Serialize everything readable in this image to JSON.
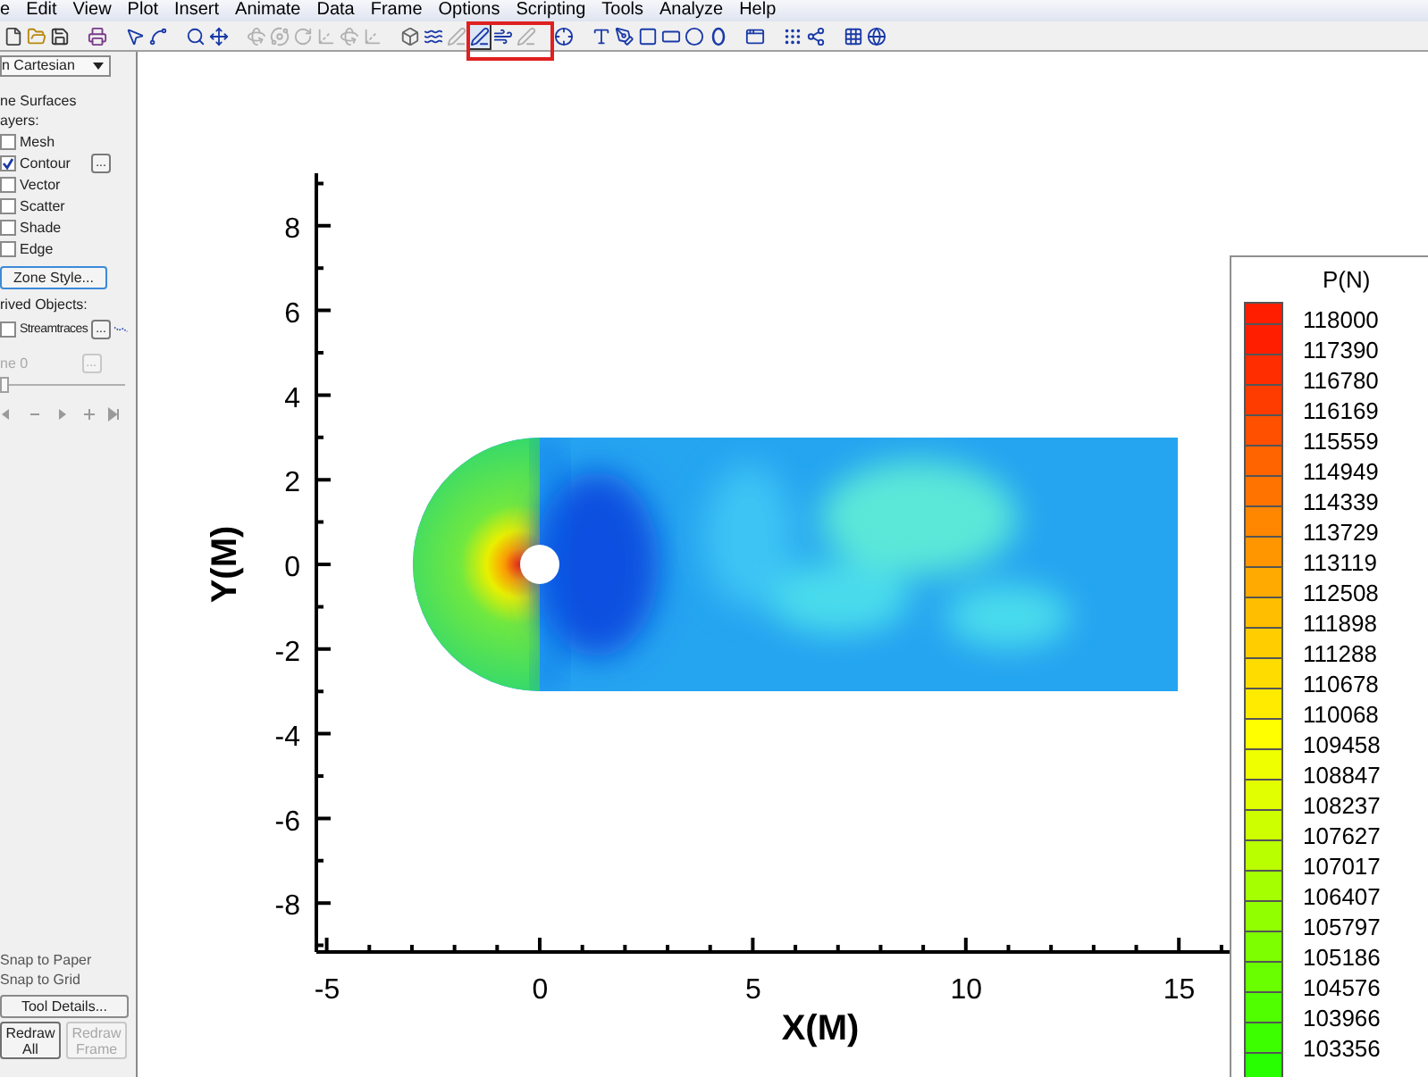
{
  "menu_bar": [
    "e",
    "Edit",
    "View",
    "Plot",
    "Insert",
    "Animate",
    "Data",
    "Frame",
    "Options",
    "Scripting",
    "Tools",
    "Analyze",
    "Help"
  ],
  "toolbar": [
    {
      "kind": "new",
      "disabled": false,
      "selected": false
    },
    {
      "kind": "open",
      "disabled": false,
      "selected": false
    },
    {
      "kind": "save",
      "disabled": false,
      "selected": false
    },
    {
      "kind": "gap"
    },
    {
      "kind": "print",
      "disabled": false,
      "selected": false
    },
    {
      "kind": "gap"
    },
    {
      "kind": "pointer",
      "disabled": false,
      "selected": false
    },
    {
      "kind": "adjust",
      "disabled": false,
      "selected": false
    },
    {
      "kind": "gap"
    },
    {
      "kind": "zoom",
      "disabled": false,
      "selected": false
    },
    {
      "kind": "move",
      "disabled": false,
      "selected": false
    },
    {
      "kind": "gap"
    },
    {
      "kind": "rotate",
      "disabled": true,
      "selected": false
    },
    {
      "kind": "orbit",
      "disabled": true,
      "selected": false
    },
    {
      "kind": "spin",
      "disabled": true,
      "selected": false
    },
    {
      "kind": "axis",
      "disabled": true,
      "selected": false
    },
    {
      "kind": "rotate",
      "disabled": true,
      "selected": false
    },
    {
      "kind": "axis",
      "disabled": true,
      "selected": false
    },
    {
      "kind": "gap"
    },
    {
      "kind": "slice",
      "disabled": false,
      "selected": false
    },
    {
      "kind": "wave",
      "disabled": false,
      "selected": false
    },
    {
      "kind": "contour",
      "disabled": true,
      "selected": false
    },
    {
      "kind": "contour-add",
      "disabled": false,
      "selected": true
    },
    {
      "kind": "streamtrace",
      "disabled": false,
      "selected": false
    },
    {
      "kind": "contour",
      "disabled": true,
      "selected": false
    },
    {
      "kind": "gap"
    },
    {
      "kind": "probe",
      "disabled": false,
      "selected": false
    },
    {
      "kind": "gap"
    },
    {
      "kind": "text",
      "disabled": false,
      "selected": false
    },
    {
      "kind": "polyline",
      "disabled": false,
      "selected": false
    },
    {
      "kind": "square",
      "disabled": false,
      "selected": false
    },
    {
      "kind": "rect",
      "disabled": false,
      "selected": false
    },
    {
      "kind": "circle",
      "disabled": false,
      "selected": false
    },
    {
      "kind": "ellipse",
      "disabled": false,
      "selected": false
    },
    {
      "kind": "gap"
    },
    {
      "kind": "frame",
      "disabled": false,
      "selected": false
    },
    {
      "kind": "gap"
    },
    {
      "kind": "scatter",
      "disabled": false,
      "selected": false
    },
    {
      "kind": "dots",
      "disabled": false,
      "selected": false
    },
    {
      "kind": "gap"
    },
    {
      "kind": "grid",
      "disabled": false,
      "selected": false
    },
    {
      "kind": "globe",
      "disabled": false,
      "selected": false
    }
  ],
  "sidebar": {
    "plot_type_dropdown": "n Cartesian",
    "zone_surfaces_label": "ne Surfaces",
    "layers_label": "ayers:",
    "layers": [
      {
        "label": "Mesh",
        "checked": false
      },
      {
        "label": "Contour",
        "checked": true,
        "details_button": "..."
      },
      {
        "label": "Vector",
        "checked": false
      },
      {
        "label": "Scatter",
        "checked": false
      },
      {
        "label": "Shade",
        "checked": false
      },
      {
        "label": "Edge",
        "checked": false
      }
    ],
    "zone_style_button": "Zone Style...",
    "derived_objects_label": "rived Objects:",
    "derived_objects": [
      {
        "label": "Streamtraces",
        "checked": false,
        "details_button": "..."
      }
    ],
    "slice_field": {
      "label": "ne 0",
      "details_button": "...",
      "disabled": true
    },
    "slider": {
      "level": 0.0
    },
    "snap_options": [
      "Snap to Paper",
      "Snap to Grid"
    ],
    "tool_details_button": "Tool Details...",
    "redraw_buttons": [
      {
        "label": "Redraw All",
        "disabled": false
      },
      {
        "label": "Redraw Frame",
        "disabled": true
      }
    ]
  },
  "plot": {
    "x_axis": {
      "title": "X(M)",
      "ticks": [
        "-5",
        "0",
        "5",
        "10",
        "15"
      ]
    },
    "y_axis": {
      "title": "Y(M)",
      "ticks": [
        "8",
        "6",
        "4",
        "2",
        "0",
        "-2",
        "-4",
        "-6",
        "-8"
      ]
    },
    "legend": {
      "title": "P(N)",
      "levels": [
        {
          "label": "118000",
          "color": "#ff1e00"
        },
        {
          "label": "117390",
          "color": "#ff2d00"
        },
        {
          "label": "116780",
          "color": "#ff3c00"
        },
        {
          "label": "116169",
          "color": "#ff5000"
        },
        {
          "label": "115559",
          "color": "#ff6400"
        },
        {
          "label": "114949",
          "color": "#ff7300"
        },
        {
          "label": "114339",
          "color": "#ff8700"
        },
        {
          "label": "113729",
          "color": "#ff9600"
        },
        {
          "label": "113119",
          "color": "#ffaa00"
        },
        {
          "label": "112508",
          "color": "#ffbe00"
        },
        {
          "label": "111898",
          "color": "#ffcd00"
        },
        {
          "label": "111288",
          "color": "#ffdc00"
        },
        {
          "label": "110678",
          "color": "#ffeb00"
        },
        {
          "label": "110068",
          "color": "#ffff00"
        },
        {
          "label": "109458",
          "color": "#f0ff00"
        },
        {
          "label": "108847",
          "color": "#e1ff00"
        },
        {
          "label": "108237",
          "color": "#cdff00"
        },
        {
          "label": "107627",
          "color": "#b9ff00"
        },
        {
          "label": "107017",
          "color": "#a5ff00"
        },
        {
          "label": "106407",
          "color": "#91ff00"
        },
        {
          "label": "105797",
          "color": "#7dff00"
        },
        {
          "label": "105186",
          "color": "#69ff00"
        },
        {
          "label": "104576",
          "color": "#50ff00"
        },
        {
          "label": "103966",
          "color": "#3cff00"
        },
        {
          "label": "103356",
          "color": "#28ff00"
        }
      ]
    }
  }
}
